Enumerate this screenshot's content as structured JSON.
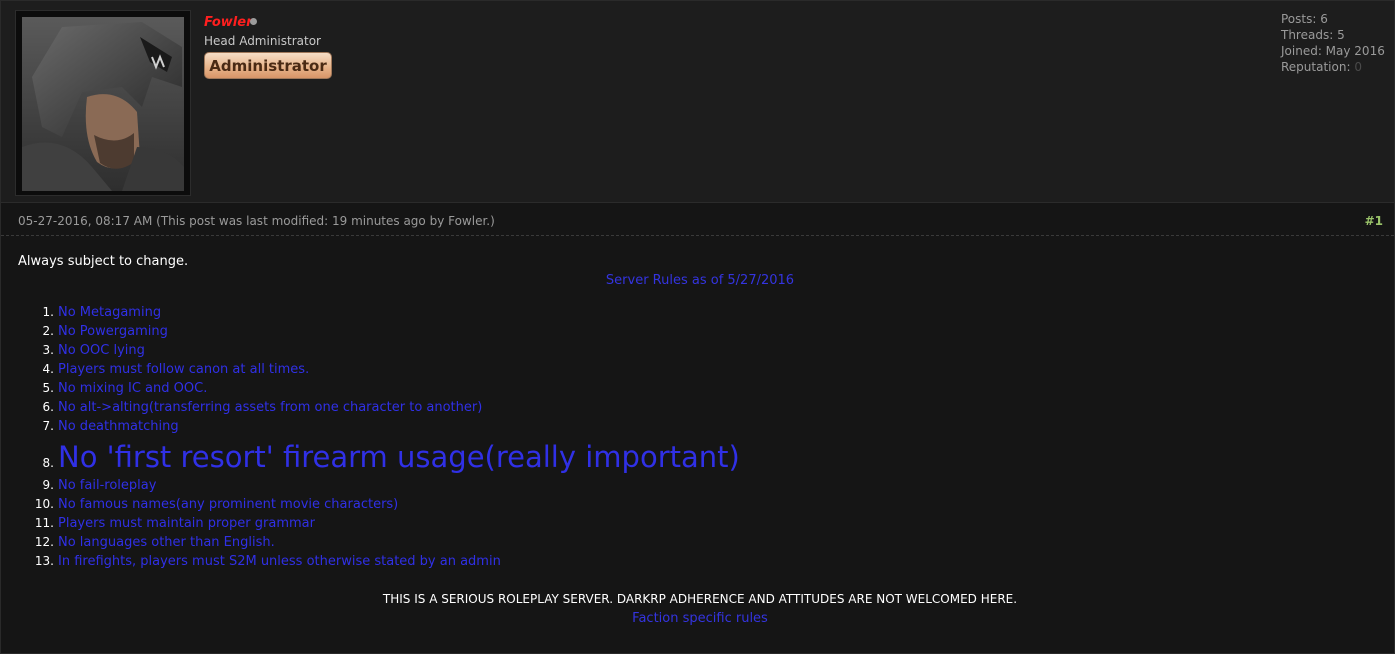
{
  "post": {
    "user": {
      "username": "Fowler",
      "user_title": "Head Administrator",
      "group_badge": "Administrator",
      "status_icon": "offline-dot-icon"
    },
    "stats": {
      "posts": "Posts: 6",
      "threads": "Threads: 5",
      "joined": "Joined: May 2016",
      "reputation_label": "Reputation:",
      "reputation_value": "0"
    },
    "meta": {
      "date_line": "05-27-2016, 08:17 AM (This post was last modified: 19 minutes ago by Fowler.)",
      "post_number": "#1"
    },
    "body": {
      "intro": "Always subject to change.",
      "rules_title": "Server Rules as of 5/27/2016",
      "rules": [
        {
          "num": "1.",
          "text": "No Metagaming"
        },
        {
          "num": "2.",
          "text": "No Powergaming"
        },
        {
          "num": "3.",
          "text": "No OOC lying"
        },
        {
          "num": "4.",
          "text": "Players must follow canon at all times."
        },
        {
          "num": "5.",
          "text": "No mixing IC and OOC."
        },
        {
          "num": "6.",
          "text": "No alt->alting(transferring assets from one character to another)"
        },
        {
          "num": "7.",
          "text": "No deathmatching"
        },
        {
          "num": "8.",
          "text": "No 'first resort' firearm usage(really important)"
        },
        {
          "num": "9.",
          "text": "No fail-roleplay"
        },
        {
          "num": "10.",
          "text": "No famous names(any prominent movie characters)"
        },
        {
          "num": "11.",
          "text": "Players must maintain proper grammar"
        },
        {
          "num": "12.",
          "text": "No languages other than English."
        },
        {
          "num": "13.",
          "text": "In firefights, players must S2M unless otherwise stated by an admin"
        }
      ],
      "notice": "THIS IS A SERIOUS ROLEPLAY SERVER. DARKRP ADHERENCE AND ATTITUDES ARE NOT WELCOMED HERE.",
      "faction_link": "Faction specific rules"
    }
  }
}
